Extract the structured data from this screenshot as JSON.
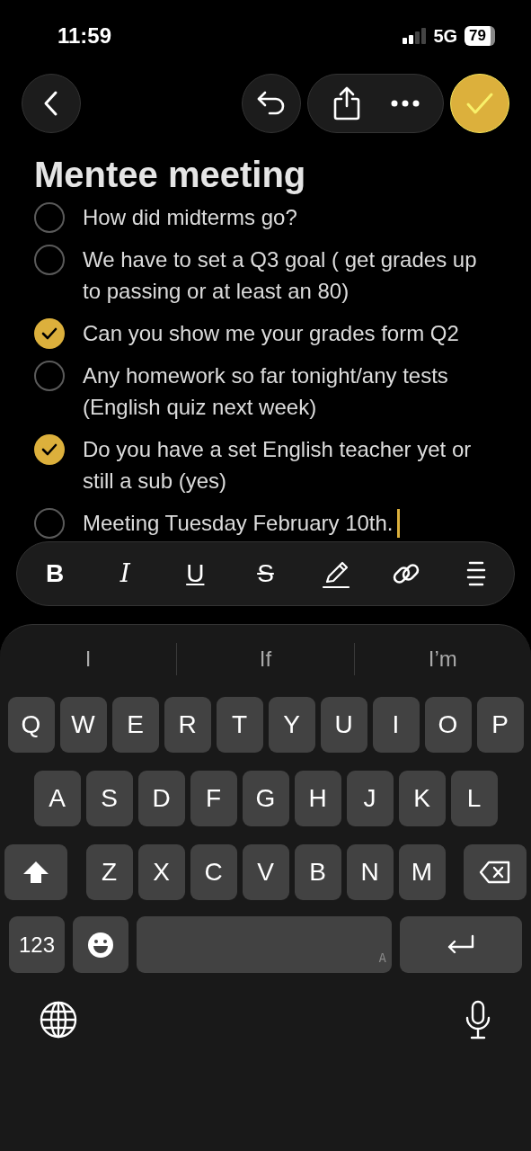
{
  "status_bar": {
    "time": "11:59",
    "network": "5G",
    "battery": "79"
  },
  "title": "Mentee meeting",
  "checklist": [
    {
      "text": "How did midterms go?",
      "checked": false,
      "editing": false
    },
    {
      "text": "We have to set a Q3 goal ( get grades up to passing or at least an 80)",
      "checked": false,
      "editing": false
    },
    {
      "text": "Can you show me your grades form Q2",
      "checked": true,
      "editing": false
    },
    {
      "text": "Any homework so far tonight/any tests (English quiz next week)",
      "checked": false,
      "editing": false
    },
    {
      "text": "Do you have a set English teacher yet or still a sub (yes)",
      "checked": true,
      "editing": false
    },
    {
      "text": "Meeting Tuesday February 10th.",
      "checked": false,
      "editing": true
    }
  ],
  "format_bar": [
    {
      "kind": "bold",
      "label": "B"
    },
    {
      "kind": "italic",
      "label": "I"
    },
    {
      "kind": "underline",
      "label": "U"
    },
    {
      "kind": "strike",
      "label": "S"
    },
    {
      "kind": "highlight"
    },
    {
      "kind": "link"
    },
    {
      "kind": "list"
    }
  ],
  "suggestions": [
    "I",
    "If",
    "I’m"
  ],
  "keyboard": {
    "rows": [
      [
        "Q",
        "W",
        "E",
        "R",
        "T",
        "Y",
        "U",
        "I",
        "O",
        "P"
      ],
      [
        "A",
        "S",
        "D",
        "F",
        "G",
        "H",
        "J",
        "K",
        "L"
      ],
      [
        "Z",
        "X",
        "C",
        "V",
        "B",
        "N",
        "M"
      ]
    ],
    "numbers_key": "123",
    "space_hint": "A"
  }
}
